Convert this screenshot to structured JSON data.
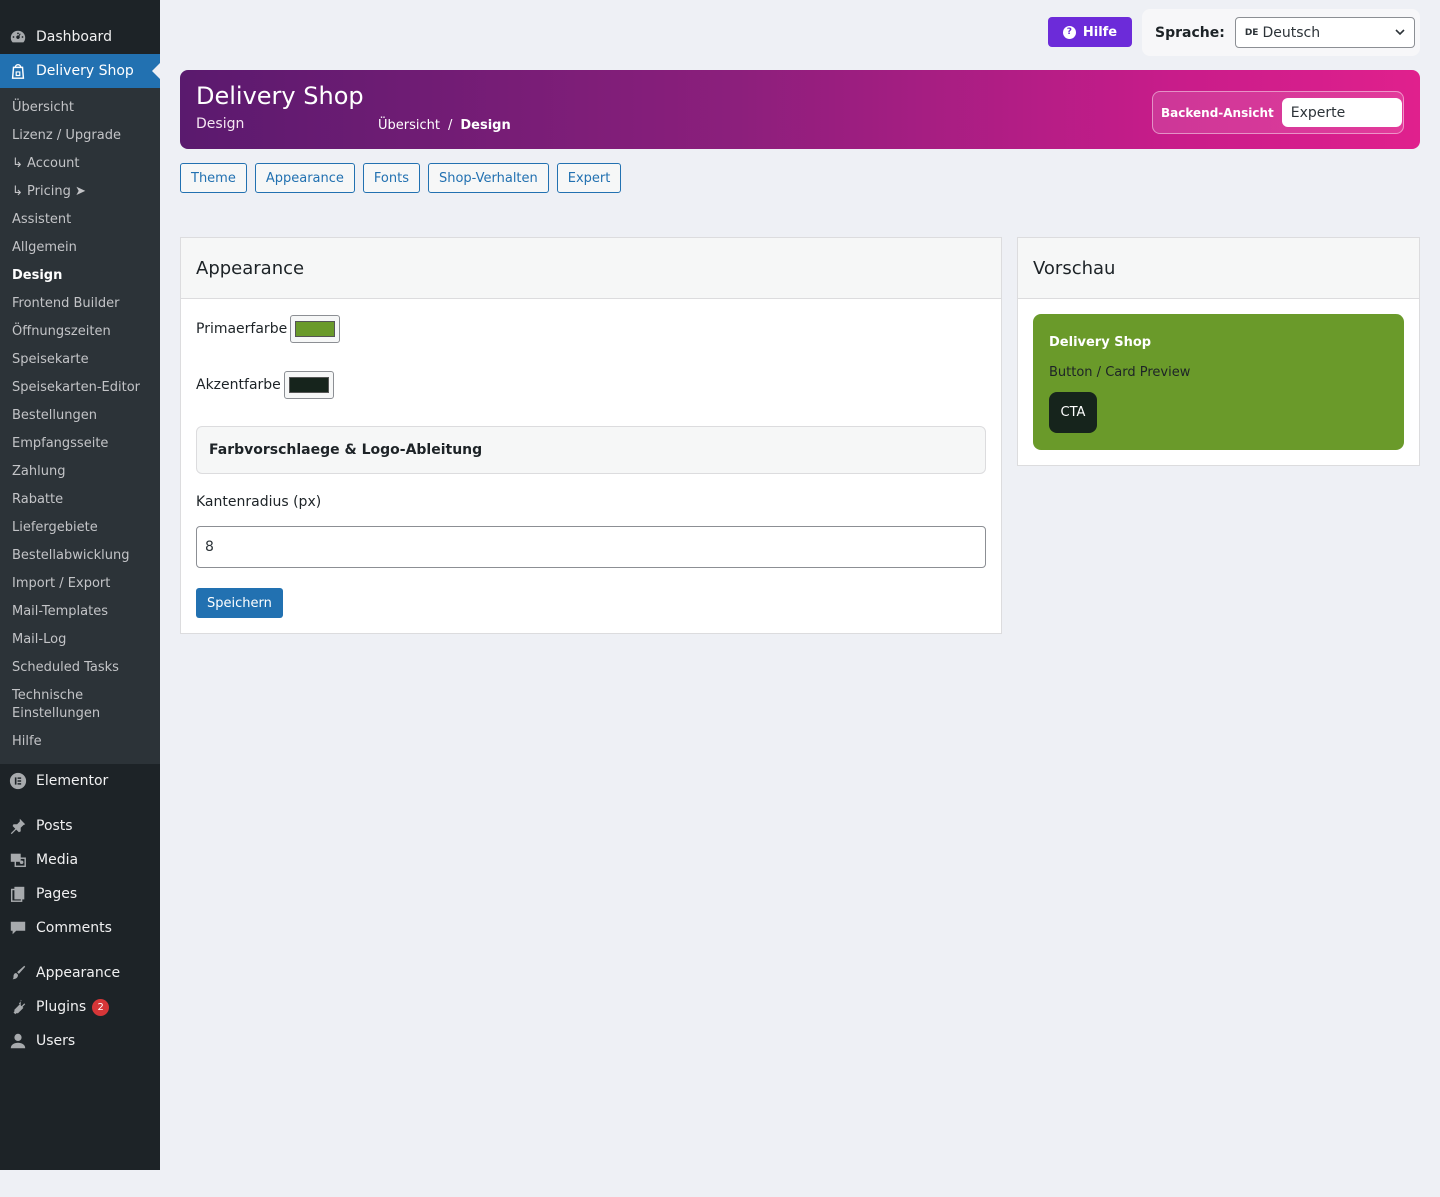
{
  "sidebar": {
    "dashboard": "Dashboard",
    "delivery_shop": "Delivery Shop",
    "submenu": [
      "Übersicht",
      "Lizenz / Upgrade",
      "↳ Account",
      "↳ Pricing ➤",
      "Assistent",
      "Allgemein",
      "Design",
      "Frontend Builder",
      "Öffnungszeiten",
      "Speisekarte",
      "Speisekarten-Editor",
      "Bestellungen",
      "Empfangsseite",
      "Zahlung",
      "Rabatte",
      "Liefergebiete",
      "Bestellabwicklung",
      "Import / Export",
      "Mail-Templates",
      "Mail-Log",
      "Scheduled Tasks",
      "Technische Einstellungen",
      "Hilfe"
    ],
    "elementor": "Elementor",
    "posts": "Posts",
    "media": "Media",
    "pages": "Pages",
    "comments": "Comments",
    "appearance": "Appearance",
    "plugins": "Plugins",
    "plugins_badge": "2",
    "users": "Users"
  },
  "topbar": {
    "help": "Hilfe",
    "language_label": "Sprache:",
    "language_flag": "DE",
    "language_value": "Deutsch"
  },
  "header": {
    "title": "Delivery Shop",
    "subtitle": "Design",
    "breadcrumb_home": "Übersicht",
    "breadcrumb_sep": "/",
    "breadcrumb_current": "Design",
    "backend_view_label": "Backend-Ansicht",
    "backend_view_value": "Experte"
  },
  "tabs": [
    "Theme",
    "Appearance",
    "Fonts",
    "Shop-Verhalten",
    "Expert"
  ],
  "appearance": {
    "heading": "Appearance",
    "primary_label": "Primaerfarbe",
    "accent_label": "Akzentfarbe",
    "suggestions": "Farbvorschlaege & Logo-Ableitung",
    "radius_label": "Kantenradius (px)",
    "radius_value": "8",
    "save": "Speichern"
  },
  "preview": {
    "heading": "Vorschau",
    "card_title": "Delivery Shop",
    "card_subtitle": "Button / Card Preview",
    "cta": "CTA"
  },
  "colors": {
    "primary": "#6a9a2a",
    "accent": "#16241c",
    "wp_blue": "#2271b1",
    "help_purple": "#6c2bd9"
  }
}
